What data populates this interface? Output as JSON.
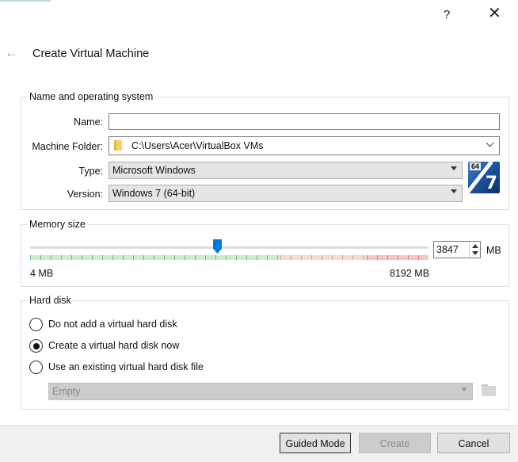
{
  "window": {
    "help_label": "?",
    "close_label": "✕",
    "back_icon": "back-arrow-icon"
  },
  "wizard": {
    "title": "Create Virtual Machine"
  },
  "name_os": {
    "group_title": "Name and operating system",
    "name_label": "Name:",
    "name_value": "",
    "folder_label": "Machine Folder:",
    "folder_value": "C:\\Users\\Acer\\VirtualBox VMs",
    "type_label": "Type:",
    "type_value": "Microsoft Windows",
    "version_label": "Version:",
    "version_value": "Windows 7 (64-bit)",
    "os_icon": {
      "bits": "64",
      "version": "7"
    }
  },
  "memory": {
    "group_title": "Memory size",
    "min_label": "4 MB",
    "max_label": "8192 MB",
    "value": "3847",
    "unit": "MB",
    "slider_min": 4,
    "slider_max": 8192,
    "slider_value": 3847
  },
  "hard_disk": {
    "group_title": "Hard disk",
    "options": [
      {
        "label": "Do not add a virtual hard disk",
        "checked": false
      },
      {
        "label": "Create a virtual hard disk now",
        "checked": true
      },
      {
        "label": "Use an existing virtual hard disk file",
        "checked": false
      }
    ],
    "existing_disk_value": "Empty"
  },
  "footer": {
    "guided_mode_label": "Guided Mode",
    "create_label": "Create",
    "cancel_label": "Cancel"
  }
}
